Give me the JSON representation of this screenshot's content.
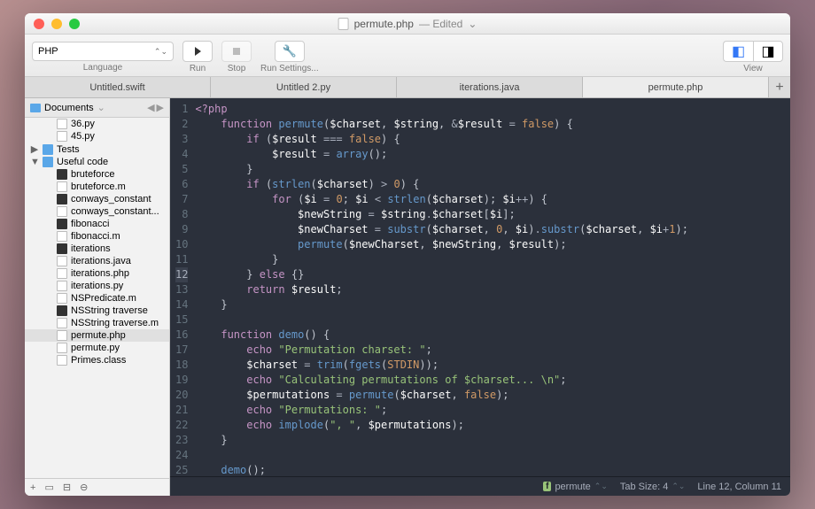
{
  "window": {
    "title": "permute.php",
    "title_status": "— Edited"
  },
  "toolbar": {
    "language_label": "Language",
    "language_value": "PHP",
    "run_label": "Run",
    "stop_label": "Stop",
    "settings_label": "Run Settings...",
    "view_label": "View"
  },
  "tabs": [
    {
      "label": "Untitled.swift",
      "active": false
    },
    {
      "label": "Untitled 2.py",
      "active": false
    },
    {
      "label": "iterations.java",
      "active": false
    },
    {
      "label": "permute.php",
      "active": true
    }
  ],
  "sidebar": {
    "header": "Documents",
    "items": [
      {
        "indent": 1,
        "icon": "file",
        "label": "36.py"
      },
      {
        "indent": 1,
        "icon": "file",
        "label": "45.py"
      },
      {
        "indent": 0,
        "icon": "folder",
        "label": "Tests",
        "arrow": "▶"
      },
      {
        "indent": 0,
        "icon": "folder",
        "label": "Useful code",
        "arrow": "▼"
      },
      {
        "indent": 1,
        "icon": "exec",
        "label": "bruteforce"
      },
      {
        "indent": 1,
        "icon": "file",
        "label": "bruteforce.m"
      },
      {
        "indent": 1,
        "icon": "exec",
        "label": "conways_constant"
      },
      {
        "indent": 1,
        "icon": "file",
        "label": "conways_constant..."
      },
      {
        "indent": 1,
        "icon": "exec",
        "label": "fibonacci"
      },
      {
        "indent": 1,
        "icon": "file",
        "label": "fibonacci.m"
      },
      {
        "indent": 1,
        "icon": "exec",
        "label": "iterations"
      },
      {
        "indent": 1,
        "icon": "file",
        "label": "iterations.java"
      },
      {
        "indent": 1,
        "icon": "file",
        "label": "iterations.php"
      },
      {
        "indent": 1,
        "icon": "file",
        "label": "iterations.py"
      },
      {
        "indent": 1,
        "icon": "file",
        "label": "NSPredicate.m"
      },
      {
        "indent": 1,
        "icon": "exec",
        "label": "NSString traverse"
      },
      {
        "indent": 1,
        "icon": "file",
        "label": "NSString traverse.m"
      },
      {
        "indent": 1,
        "icon": "file",
        "label": "permute.php",
        "selected": true
      },
      {
        "indent": 1,
        "icon": "file",
        "label": "permute.py"
      },
      {
        "indent": 1,
        "icon": "file",
        "label": "Primes.class"
      }
    ]
  },
  "editor": {
    "line_count": 26,
    "current_line": 12,
    "lines_html": [
      "<span class='tk-php'>&lt;?php</span>",
      "    <span class='tk-kw'>function</span> <span class='tk-fn'>permute</span><span class='tk-punc'>(</span><span class='tk-var'>$charset</span><span class='tk-punc'>,</span> <span class='tk-var'>$string</span><span class='tk-punc'>,</span> <span class='tk-op'>&amp;</span><span class='tk-var'>$result</span> <span class='tk-op'>=</span> <span class='tk-const'>false</span><span class='tk-punc'>) {</span>",
      "        <span class='tk-kw'>if</span> <span class='tk-punc'>(</span><span class='tk-var'>$result</span> <span class='tk-op'>===</span> <span class='tk-const'>false</span><span class='tk-punc'>) {</span>",
      "            <span class='tk-var'>$result</span> <span class='tk-op'>=</span> <span class='tk-fn'>array</span><span class='tk-punc'>();</span>",
      "        <span class='tk-punc'>}</span>",
      "        <span class='tk-kw'>if</span> <span class='tk-punc'>(</span><span class='tk-fn'>strlen</span><span class='tk-punc'>(</span><span class='tk-var'>$charset</span><span class='tk-punc'>)</span> <span class='tk-op'>&gt;</span> <span class='tk-num'>0</span><span class='tk-punc'>) {</span>",
      "            <span class='tk-kw'>for</span> <span class='tk-punc'>(</span><span class='tk-var'>$i</span> <span class='tk-op'>=</span> <span class='tk-num'>0</span><span class='tk-punc'>;</span> <span class='tk-var'>$i</span> <span class='tk-op'>&lt;</span> <span class='tk-fn'>strlen</span><span class='tk-punc'>(</span><span class='tk-var'>$charset</span><span class='tk-punc'>);</span> <span class='tk-var'>$i</span><span class='tk-op'>++</span><span class='tk-punc'>) {</span>",
      "                <span class='tk-var'>$newString</span> <span class='tk-op'>=</span> <span class='tk-var'>$string</span><span class='tk-op'>.</span><span class='tk-var'>$charset</span><span class='tk-punc'>[</span><span class='tk-var'>$i</span><span class='tk-punc'>];</span>",
      "                <span class='tk-var'>$newCharset</span> <span class='tk-op'>=</span> <span class='tk-fn'>substr</span><span class='tk-punc'>(</span><span class='tk-var'>$charset</span><span class='tk-punc'>,</span> <span class='tk-num'>0</span><span class='tk-punc'>,</span> <span class='tk-var'>$i</span><span class='tk-punc'>)</span><span class='tk-op'>.</span><span class='tk-fn'>substr</span><span class='tk-punc'>(</span><span class='tk-var'>$charset</span><span class='tk-punc'>,</span> <span class='tk-var'>$i</span><span class='tk-op'>+</span><span class='tk-num'>1</span><span class='tk-punc'>);</span>",
      "                <span class='tk-fn'>permute</span><span class='tk-punc'>(</span><span class='tk-var'>$newCharset</span><span class='tk-punc'>,</span> <span class='tk-var'>$newString</span><span class='tk-punc'>,</span> <span class='tk-var'>$result</span><span class='tk-punc'>);</span>",
      "            <span class='tk-punc'>}</span>",
      "        <span class='tk-punc'>}</span> <span class='tk-kw'>else</span> <span class='tk-punc'>{}</span>",
      "        <span class='tk-kw'>return</span> <span class='tk-var'>$result</span><span class='tk-punc'>;</span>",
      "    <span class='tk-punc'>}</span>",
      "",
      "    <span class='tk-kw'>function</span> <span class='tk-fn'>demo</span><span class='tk-punc'>() {</span>",
      "        <span class='tk-kw'>echo</span> <span class='tk-str'>\"Permutation charset: \"</span><span class='tk-punc'>;</span>",
      "        <span class='tk-var'>$charset</span> <span class='tk-op'>=</span> <span class='tk-fn'>trim</span><span class='tk-punc'>(</span><span class='tk-fn'>fgets</span><span class='tk-punc'>(</span><span class='tk-const'>STDIN</span><span class='tk-punc'>));</span>",
      "        <span class='tk-kw'>echo</span> <span class='tk-str'>\"Calculating permutations of $charset... \\n\"</span><span class='tk-punc'>;</span>",
      "        <span class='tk-var'>$permutations</span> <span class='tk-op'>=</span> <span class='tk-fn'>permute</span><span class='tk-punc'>(</span><span class='tk-var'>$charset</span><span class='tk-punc'>,</span> <span class='tk-const'>false</span><span class='tk-punc'>);</span>",
      "        <span class='tk-kw'>echo</span> <span class='tk-str'>\"Permutations: \"</span><span class='tk-punc'>;</span>",
      "        <span class='tk-kw'>echo</span> <span class='tk-fn'>implode</span><span class='tk-punc'>(</span><span class='tk-str'>\", \"</span><span class='tk-punc'>,</span> <span class='tk-var'>$permutations</span><span class='tk-punc'>);</span>",
      "    <span class='tk-punc'>}</span>",
      "",
      "    <span class='tk-fn'>demo</span><span class='tk-punc'>();</span>",
      "<span class='tk-php'>?&gt;</span>"
    ]
  },
  "statusbar": {
    "symbol": "permute",
    "tabsize": "Tab Size: 4",
    "position": "Line 12, Column 11"
  }
}
